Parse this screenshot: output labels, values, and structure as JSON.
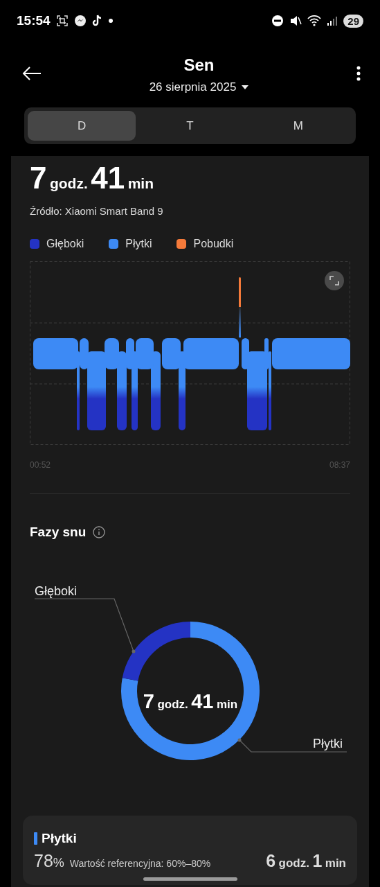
{
  "status_bar": {
    "time": "15:54",
    "battery": "29"
  },
  "header": {
    "title": "Sen",
    "date": "26 sierpnia 2025"
  },
  "tabs": [
    {
      "label": "D",
      "selected": true
    },
    {
      "label": "T",
      "selected": false
    },
    {
      "label": "M",
      "selected": false
    }
  ],
  "summary": {
    "duration": {
      "hours": "7",
      "hours_unit": "godz.",
      "minutes": "41",
      "minutes_unit": "min"
    },
    "source": "Źródło: Xiaomi Smart Band 9",
    "legend": [
      {
        "label": "Głęboki",
        "color": "#2433c4"
      },
      {
        "label": "Płytki",
        "color": "#3d8af5"
      },
      {
        "label": "Pobudki",
        "color": "#f57a3a"
      }
    ],
    "timeline": {
      "start": "00:52",
      "end": "08:37"
    }
  },
  "phases": {
    "title": "Fazy snu",
    "center_duration": {
      "hours": "7",
      "hours_unit": "godz.",
      "minutes": "41",
      "minutes_unit": "min"
    },
    "chart_data": {
      "type": "donut",
      "categories": [
        "Głęboki",
        "Płytki"
      ],
      "values": [
        22,
        78
      ]
    }
  },
  "stage_card": {
    "name": "Płytki",
    "color": "#3d8af5",
    "percent": "78",
    "percent_unit": "%",
    "reference": "Wartość referencyjna: 60%–80%",
    "duration": {
      "hours": "6",
      "hours_unit": "godz.",
      "minutes": "1",
      "minutes_unit": "min"
    }
  }
}
